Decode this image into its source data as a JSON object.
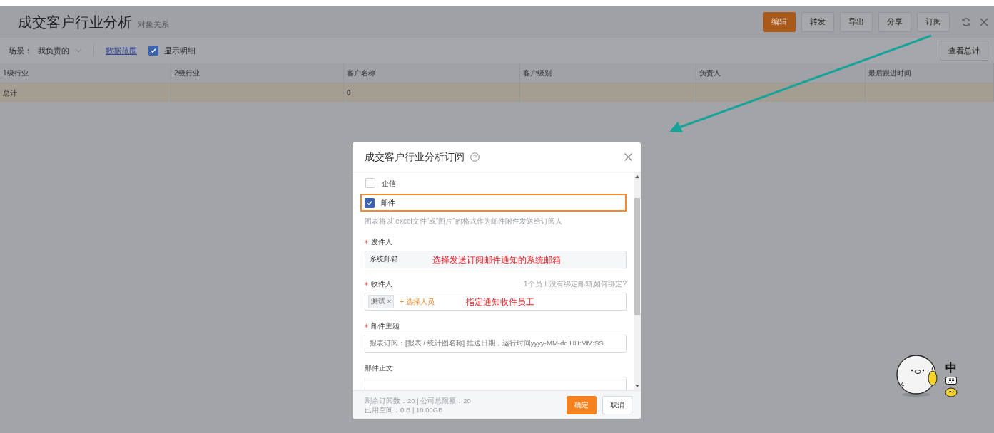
{
  "page": {
    "title": "成交客户行业分析",
    "subtitle": "对象关系"
  },
  "actions": [
    {
      "label": "编辑",
      "kind": "primary"
    },
    {
      "label": "转发",
      "kind": "default"
    },
    {
      "label": "导出",
      "kind": "default"
    },
    {
      "label": "分享",
      "kind": "default"
    },
    {
      "label": "订阅",
      "kind": "default"
    }
  ],
  "filters": {
    "scene_label": "场景：",
    "scene_value": "我负责的",
    "data_range_link": "数据范围",
    "show_detail": {
      "label": "显示明细",
      "checked": true
    }
  },
  "summary_button": "查看总计",
  "table": {
    "columns": [
      "1级行业",
      "2级行业",
      "客户名称",
      "客户级别",
      "负责人",
      "最后跟进时间"
    ],
    "rows": [
      {
        "total": true,
        "cells": [
          "总计",
          null,
          "0",
          null,
          null,
          null
        ]
      }
    ]
  },
  "dialog": {
    "title": "成交客户行业分析订阅",
    "channels": [
      {
        "label": "企信",
        "checked": false,
        "highlighted": false
      },
      {
        "label": "邮件",
        "checked": true,
        "highlighted": true
      }
    ],
    "hint": "图表将以“excel文件”或“图片”的格式作为邮件附件发送给订阅人",
    "fields": [
      {
        "kind": "readonly",
        "label": "发件人",
        "required": true,
        "value": "系统邮箱",
        "annotation": "选择发送订阅邮件通知的系统邮箱"
      },
      {
        "kind": "people",
        "label": "收件人",
        "required": true,
        "note": "1个员工没有绑定邮箱,",
        "note_link": "如何绑定?",
        "tags": [
          {
            "label": "测试",
            "remove": "×"
          }
        ],
        "add_label": "+ 选择人员",
        "annotation": "指定通知收件员工"
      },
      {
        "kind": "text",
        "label": "邮件主题",
        "required": true,
        "placeholder": "报表订阅：[报表 / 统计图名称] 推送日期，运行时间yyyy-MM-dd HH:MM:SS"
      },
      {
        "kind": "textarea",
        "label": "邮件正文",
        "required": false
      }
    ],
    "footer_lines": [
      "剩余订阅数：20 | 公司总限额：20",
      "已用空间：0 B | 10.00GB"
    ],
    "buttons": [
      {
        "label": "确定",
        "kind": "primary"
      },
      {
        "label": "取消",
        "kind": "default"
      }
    ]
  },
  "ime": {
    "mode": "中"
  }
}
